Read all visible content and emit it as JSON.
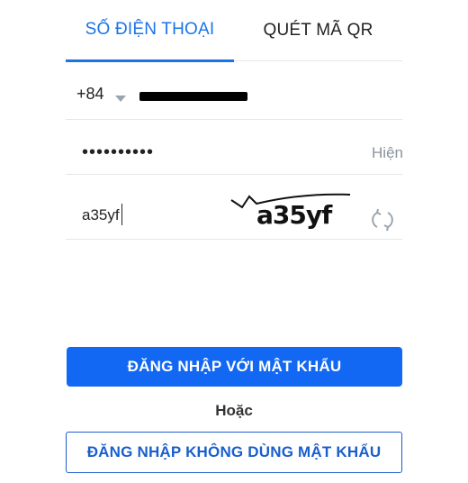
{
  "tabs": {
    "phone": "SỐ ĐIỆN THOẠI",
    "qr": "QUÉT MÃ QR"
  },
  "phone": {
    "country_code": "+84",
    "number_redacted": "redacted"
  },
  "password": {
    "masked_value": "••••••••••",
    "show_label": "Hiện"
  },
  "captcha": {
    "input_value": "a35yf",
    "image_text": "a35yf"
  },
  "buttons": {
    "login_password": "ĐĂNG NHẬP VỚI MẬT KHẨU",
    "or": "Hoặc",
    "login_no_password": "ĐĂNG NHẬP KHÔNG DÙNG MẬT KHẨU"
  },
  "colors": {
    "accent": "#1268f3",
    "tab_active": "#1a73e8",
    "divider": "#e3e6ea",
    "muted": "#8a939b"
  }
}
